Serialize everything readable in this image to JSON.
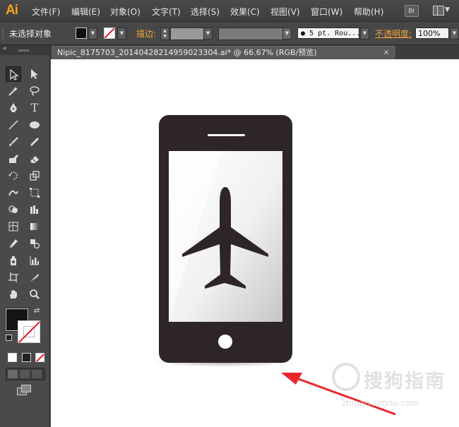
{
  "app": {
    "logo": "Ai"
  },
  "menu": {
    "items": [
      {
        "label": "文件(F)"
      },
      {
        "label": "编辑(E)"
      },
      {
        "label": "对象(O)"
      },
      {
        "label": "文字(T)"
      },
      {
        "label": "选择(S)"
      },
      {
        "label": "效果(C)"
      },
      {
        "label": "视图(V)"
      },
      {
        "label": "窗口(W)"
      },
      {
        "label": "帮助(H)"
      }
    ],
    "bridge_label": "Br"
  },
  "control": {
    "selection_status": "未选择对象",
    "stroke_label": "描边:",
    "brush_value": "● 5 pt. Rou...",
    "opacity_label": "不透明度:",
    "opacity_value": "100%"
  },
  "document": {
    "tab_title": "Nipic_8175703_20140428214959023304.ai* @ 66.67% (RGB/预览)",
    "close_glyph": "×"
  },
  "watermark": {
    "text": "搜狗指南",
    "url": "zhinan.sogou.com"
  },
  "colors": {
    "phone_body": "#2e2626",
    "screen_top": "#ffffff",
    "screen_bottom": "#c9c9c9",
    "arrow": "#e8262a",
    "accent_label": "#f0a33a"
  },
  "icons": [
    "selection-tool",
    "direct-selection-tool",
    "magic-wand-tool",
    "lasso-tool",
    "pen-tool",
    "type-tool",
    "line-tool",
    "ellipse-tool",
    "paintbrush-tool",
    "pencil-tool",
    "blob-brush-tool",
    "eraser-tool",
    "rotate-tool",
    "scale-tool",
    "warp-tool",
    "free-transform-tool",
    "shape-builder-tool",
    "graph-tool",
    "mesh-tool",
    "gradient-tool",
    "eyedropper-tool",
    "blend-tool",
    "symbol-sprayer-tool",
    "column-graph-tool",
    "artboard-tool",
    "slice-tool",
    "hand-tool",
    "zoom-tool",
    "airplane-icon"
  ]
}
